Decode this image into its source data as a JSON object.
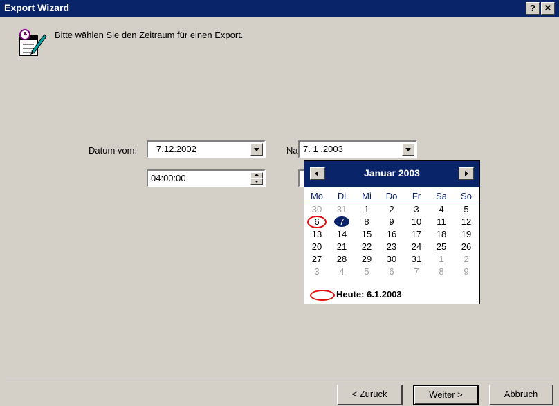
{
  "window": {
    "title": "Export Wizard",
    "help_label": "?",
    "close_label": "✕"
  },
  "intro": {
    "icon": "wizard-calendar-icon",
    "text": "Bitte wählen Sie den Zeitraum für einen Export."
  },
  "from": {
    "label": "Datum vom:",
    "date_value": "7.12.2002",
    "time_value": "04:00:00"
  },
  "to": {
    "label_partial": "Na",
    "date_value": "7. 1 .2003"
  },
  "calendar": {
    "month_label": "Januar 2003",
    "weekdays": [
      "Mo",
      "Di",
      "Mi",
      "Do",
      "Fr",
      "Sa",
      "So"
    ],
    "days": [
      {
        "d": "30",
        "other": true
      },
      {
        "d": "31",
        "other": true
      },
      {
        "d": "1"
      },
      {
        "d": "2"
      },
      {
        "d": "3"
      },
      {
        "d": "4"
      },
      {
        "d": "5"
      },
      {
        "d": "6",
        "today": true
      },
      {
        "d": "7",
        "selected": true
      },
      {
        "d": "8"
      },
      {
        "d": "9"
      },
      {
        "d": "10"
      },
      {
        "d": "11"
      },
      {
        "d": "12"
      },
      {
        "d": "13"
      },
      {
        "d": "14"
      },
      {
        "d": "15"
      },
      {
        "d": "16"
      },
      {
        "d": "17"
      },
      {
        "d": "18"
      },
      {
        "d": "19"
      },
      {
        "d": "20"
      },
      {
        "d": "21"
      },
      {
        "d": "22"
      },
      {
        "d": "23"
      },
      {
        "d": "24"
      },
      {
        "d": "25"
      },
      {
        "d": "26"
      },
      {
        "d": "27"
      },
      {
        "d": "28"
      },
      {
        "d": "29"
      },
      {
        "d": "30"
      },
      {
        "d": "31"
      },
      {
        "d": "1",
        "other": true
      },
      {
        "d": "2",
        "other": true
      },
      {
        "d": "3",
        "other": true
      },
      {
        "d": "4",
        "other": true
      },
      {
        "d": "5",
        "other": true
      },
      {
        "d": "6",
        "other": true
      },
      {
        "d": "7",
        "other": true
      },
      {
        "d": "8",
        "other": true
      },
      {
        "d": "9",
        "other": true
      }
    ],
    "today_label": "Heute: 6.1.2003",
    "today_color": "#e01010",
    "selected_color": "#0a246a"
  },
  "buttons": {
    "back": "< Zurück",
    "next": "Weiter >",
    "cancel": "Abbruch"
  }
}
